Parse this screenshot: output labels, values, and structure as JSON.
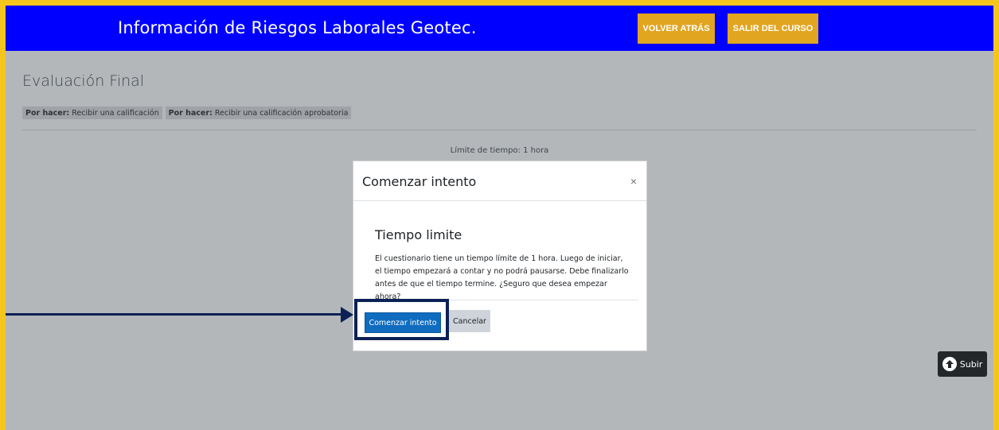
{
  "header": {
    "site_title": "Información de Riesgos Laborales Geotec.",
    "back_button": "VOLVER ATRÁS",
    "exit_button": "SALIR DEL CURSO",
    "bar_color": "#0000fe",
    "button_color": "#e2a520"
  },
  "page": {
    "title": "Evaluación Final",
    "badges": [
      {
        "prefix": "Por hacer:",
        "text": "Recibir una calificación"
      },
      {
        "prefix": "Por hacer:",
        "text": "Recibir una calificación aprobatoria"
      }
    ],
    "time_limit": "Límite de tiempo: 1 hora"
  },
  "modal": {
    "title": "Comenzar intento",
    "close_symbol": "×",
    "heading": "Tiempo limite",
    "body": "El cuestionario tiene un tiempo límite de 1 hora. Luego de iniciar, el tiempo empezará a contar y no podrá pausarse. Debe finalizarlo antes de que el tiempo termine. ¿Seguro que desea empezar ahora?",
    "start_button": "Comenzar intento",
    "cancel_button": "Cancelar"
  },
  "scroll_top": {
    "label": "Subir",
    "icon": "arrow-up-circle-icon"
  },
  "annotation": {
    "color": "#0c2155"
  }
}
